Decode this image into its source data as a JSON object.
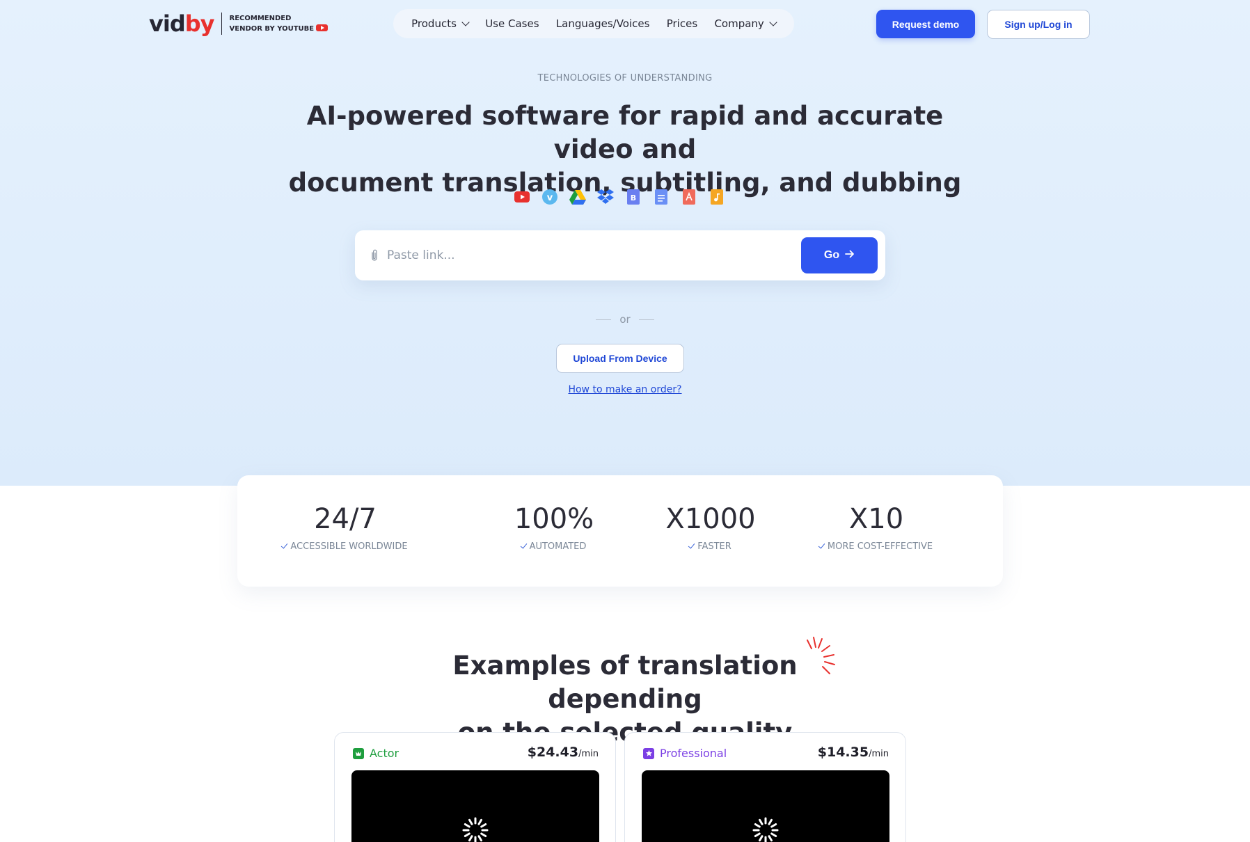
{
  "header": {
    "logo_vid": "vid",
    "logo_by": "by",
    "recommended_line1": "RECOMMENDED",
    "recommended_line2": "VENDOR BY YOUTUBE",
    "nav": [
      {
        "label": "Products",
        "dropdown": true
      },
      {
        "label": "Use Cases",
        "dropdown": false
      },
      {
        "label": "Languages/Voices",
        "dropdown": false
      },
      {
        "label": "Prices",
        "dropdown": false
      },
      {
        "label": "Company",
        "dropdown": true
      }
    ],
    "request_demo": "Request demo",
    "sign_up": "Sign up/Log in"
  },
  "hero": {
    "eyebrow": "TECHNOLOGIES OF UNDERSTANDING",
    "title_line1": "AI-powered software for rapid and accurate video and",
    "title_line2": "document translation, subtitling, and dubbing",
    "source_icons": [
      "youtube-icon",
      "vimeo-icon",
      "google-drive-icon",
      "dropbox-icon",
      "docx-icon",
      "document-icon",
      "pdf-icon",
      "audio-file-icon"
    ],
    "search_placeholder": "Paste link...",
    "go_label": "Go",
    "or_label": "or",
    "upload_label": "Upload From Device",
    "howto_label": "How to make an order?"
  },
  "stats": [
    {
      "value": "24/7",
      "label": "ACCESSIBLE WORLDWIDE"
    },
    {
      "value": "100%",
      "label": "AUTOMATED"
    },
    {
      "value": "X1000",
      "label": "FASTER"
    },
    {
      "value": "X10",
      "label": "MORE COST-EFFECTIVE"
    }
  ],
  "examples": {
    "title_line1": "Examples of translation depending",
    "title_line2": "on the selected quality",
    "cards": [
      {
        "name": "Actor",
        "price": "$24.43",
        "unit": "/min",
        "color": "#1e9e3e"
      },
      {
        "name": "Professional",
        "price": "$14.35",
        "unit": "/min",
        "color": "#7b3fe4"
      }
    ]
  },
  "colors": {
    "accent": "#2f55f0",
    "brand_red": "#e8312e",
    "hero_bg": "#e5f1fd"
  }
}
